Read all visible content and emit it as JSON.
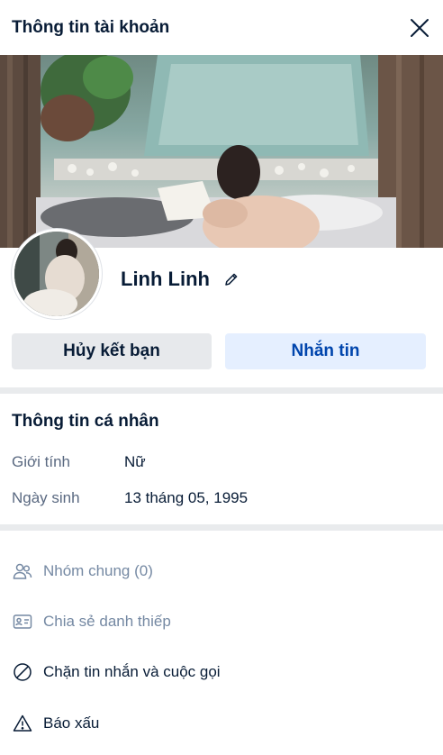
{
  "header": {
    "title": "Thông tin tài khoản",
    "close_icon": "close-icon"
  },
  "profile": {
    "name": "Linh Linh",
    "edit_icon": "pencil-icon"
  },
  "buttons": {
    "unfriend": "Hủy kết bạn",
    "message": "Nhắn tin"
  },
  "personal_info": {
    "title": "Thông tin cá nhân",
    "rows": [
      {
        "label": "Giới tính",
        "value": "Nữ"
      },
      {
        "label": "Ngày sinh",
        "value": "13 tháng 05, 1995"
      }
    ]
  },
  "actions": [
    {
      "label": "Nhóm chung (0)",
      "icon": "group-icon",
      "disabled": true
    },
    {
      "label": "Chia sẻ danh thiếp",
      "icon": "contact-card-icon",
      "disabled": true
    },
    {
      "label": "Chặn tin nhắn và cuộc gọi",
      "icon": "block-icon",
      "disabled": false
    },
    {
      "label": "Báo xấu",
      "icon": "warning-icon",
      "disabled": false
    }
  ],
  "colors": {
    "primary_text": "#081c36",
    "secondary_text": "#5a6981",
    "muted_text": "#7589a3",
    "accent": "#0045ad",
    "accent_bg": "#e5efff",
    "neutral_bg": "#e7e9ec"
  }
}
